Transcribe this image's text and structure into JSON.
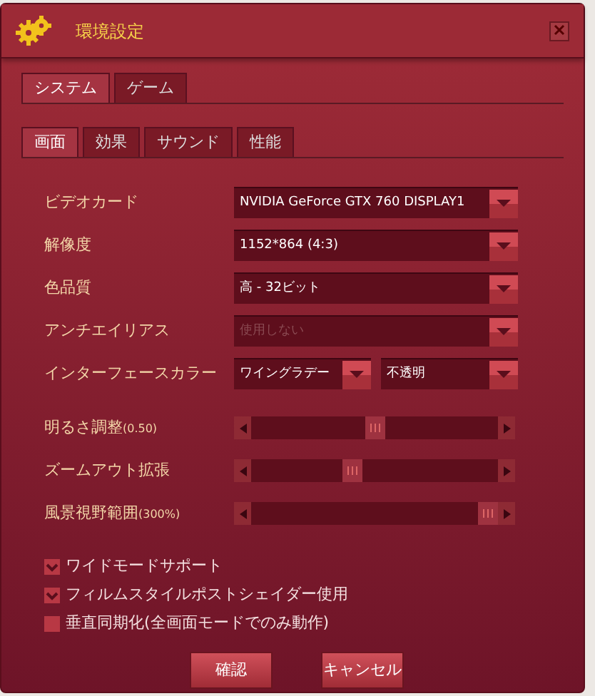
{
  "window": {
    "title": "環境設定"
  },
  "tabs": [
    {
      "label": "システム",
      "selected": true
    },
    {
      "label": "ゲーム",
      "selected": false
    }
  ],
  "subtabs": [
    {
      "label": "画面",
      "selected": true
    },
    {
      "label": "効果",
      "selected": false
    },
    {
      "label": "サウンド",
      "selected": false
    },
    {
      "label": "性能",
      "selected": false
    }
  ],
  "settings": [
    {
      "kind": "select",
      "label": "ビデオカード",
      "fields": [
        {
          "value": "NVIDIA GeForce GTX 760 DISPLAY1",
          "disabled": false
        }
      ]
    },
    {
      "kind": "select",
      "label": "解像度",
      "fields": [
        {
          "value": "1152*864 (4:3)",
          "disabled": false
        }
      ]
    },
    {
      "kind": "select",
      "label": "色品質",
      "fields": [
        {
          "value": "高 - 32ビット",
          "disabled": false
        }
      ]
    },
    {
      "kind": "select",
      "label": "アンチエイリアス",
      "fields": [
        {
          "value": "使用しない",
          "disabled": true
        }
      ]
    },
    {
      "kind": "select",
      "label": "インターフェースカラー",
      "fields": [
        {
          "value": "ワイングラデー",
          "disabled": false
        },
        {
          "value": "不透明",
          "disabled": false
        }
      ]
    },
    {
      "kind": "slider",
      "label": "明るさ調整",
      "reading": "(0.50)",
      "level": 0.5
    },
    {
      "kind": "slider",
      "label": "ズームアウト拡張",
      "level": 0.4
    },
    {
      "kind": "slider",
      "label": "風景視野範囲",
      "reading": "(300%)",
      "level": 1.0
    }
  ],
  "options": [
    {
      "label": "ワイドモードサポート",
      "checked": true
    },
    {
      "label": "フィルムスタイルポストシェイダー使用",
      "checked": true
    },
    {
      "label": "垂直同期化(全画面モードでのみ動作)",
      "checked": false
    }
  ],
  "buttons": [
    "確認",
    "キャンセル"
  ]
}
